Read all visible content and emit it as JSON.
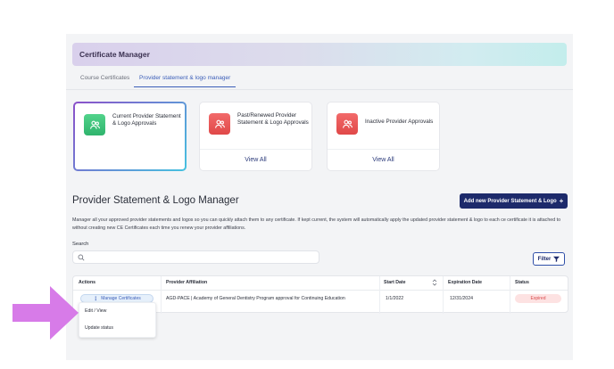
{
  "header": {
    "title": "Certificate Manager"
  },
  "tabs": [
    {
      "label": "Course Certificates",
      "active": false
    },
    {
      "label": "Provider statement & logo manager",
      "active": true
    }
  ],
  "cards": [
    {
      "label": "Current Provider Statement & Logo Approvals",
      "icon": "users-icon",
      "footer": ""
    },
    {
      "label": "Past/Renewed Provider Statement & Logo Approvals",
      "icon": "users-icon",
      "footer": "View All"
    },
    {
      "label": "Inactive Provider Approvals",
      "icon": "users-icon",
      "footer": "View All"
    }
  ],
  "section": {
    "title": "Provider Statement & Logo Manager",
    "add_button": "Add new Provider Statement & Logo",
    "description": "Manager all your approved provider statements and logos so you can quickly attach them to any certificate. If kept current, the system will automatically apply the updated provider statement & logo to each ce certificate it is attached to without creating new CE Certificates each time you renew your provider affiliations."
  },
  "search": {
    "label": "Search",
    "value": "",
    "placeholder": ""
  },
  "filter": {
    "label": "Filter"
  },
  "table": {
    "columns": [
      "Actions",
      "Provider Affiliation",
      "Start Date",
      "Expiration Date",
      "Status"
    ],
    "rows": [
      {
        "action_label": "Manage Certificates",
        "provider": "AGD-PACE | Academy of General Dentistry Program approval for Continuing Education",
        "start_date": "1/1/2022",
        "expiration_date": "12/31/2024",
        "status": "Expired"
      }
    ]
  },
  "action_menu": {
    "items": [
      "Edit / View",
      "Update status"
    ]
  },
  "colors": {
    "primary": "#1d2a6b",
    "accent": "#3a5db8",
    "success": "#2fb46d",
    "danger": "#e04848",
    "arrow": "#d77be8"
  }
}
